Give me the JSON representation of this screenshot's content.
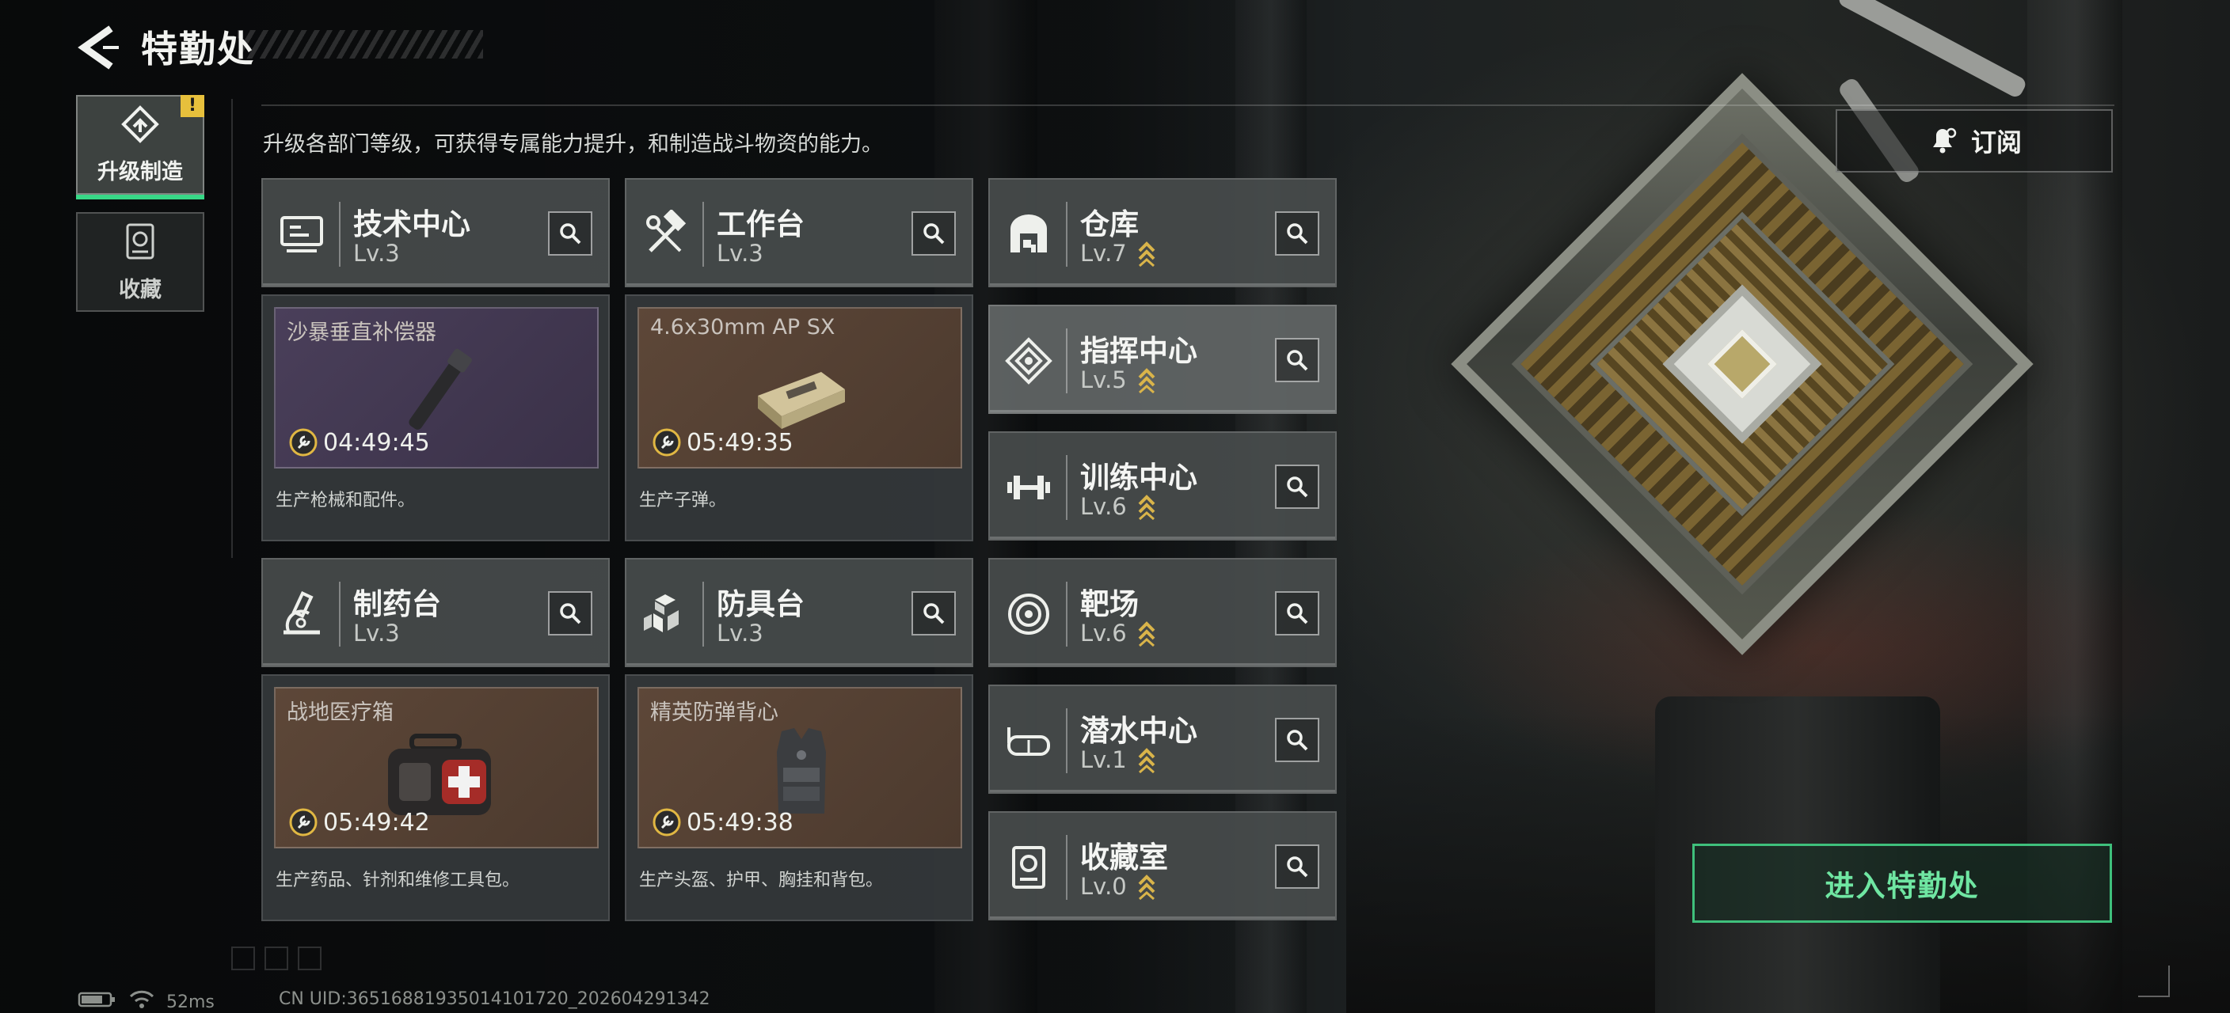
{
  "header": {
    "title": "特勤处"
  },
  "subtitle": "升级各部门等级，可获得专属能力提升，和制造战斗物资的能力。",
  "side_tabs": [
    {
      "label": "升级制造",
      "active": true,
      "badge": "!"
    },
    {
      "label": "收藏",
      "active": false
    }
  ],
  "subscribe": {
    "label": "订阅"
  },
  "production_stations": [
    {
      "name": "技术中心",
      "level": "Lv.3",
      "item": "沙暴垂直补偿器",
      "timer": "04:49:45",
      "description": "生产枪械和配件。",
      "item_bg": "purple"
    },
    {
      "name": "工作台",
      "level": "Lv.3",
      "item": "4.6x30mm AP SX",
      "timer": "05:49:35",
      "description": "生产子弹。",
      "item_bg": "brown"
    },
    {
      "name": "制药台",
      "level": "Lv.3",
      "item": "战地医疗箱",
      "timer": "05:49:42",
      "description": "生产药品、针剂和维修工具包。",
      "item_bg": "brown"
    },
    {
      "name": "防具台",
      "level": "Lv.3",
      "item": "精英防弹背心",
      "timer": "05:49:38",
      "description": "生产头盔、护甲、胸挂和背包。",
      "item_bg": "brown"
    }
  ],
  "facilities": [
    {
      "name": "仓库",
      "level": "Lv.7",
      "upgradable": true
    },
    {
      "name": "指挥中心",
      "level": "Lv.5",
      "upgradable": true,
      "highlighted": true
    },
    {
      "name": "训练中心",
      "level": "Lv.6",
      "upgradable": true
    },
    {
      "name": "靶场",
      "level": "Lv.6",
      "upgradable": true
    },
    {
      "name": "潜水中心",
      "level": "Lv.1",
      "upgradable": true
    },
    {
      "name": "收藏室",
      "level": "Lv.0",
      "upgradable": true
    }
  ],
  "enter_button": {
    "label": "进入特勤处"
  },
  "status_bar": {
    "ping": "52ms",
    "uid": "CN UID:365168819350141017​20_202604291342"
  },
  "colors": {
    "accent_green": "#38d887",
    "upgrade_chevron": "#d9b44a",
    "badge_yellow": "#e7c03c"
  },
  "icons": {
    "back": "back-arrow-icon",
    "upgrade_tab": "upgrade-build-icon",
    "collection_tab": "collection-icon",
    "subscribe": "bell-icon",
    "search": "magnifier-icon",
    "timer": "wrench-timer-icon"
  }
}
